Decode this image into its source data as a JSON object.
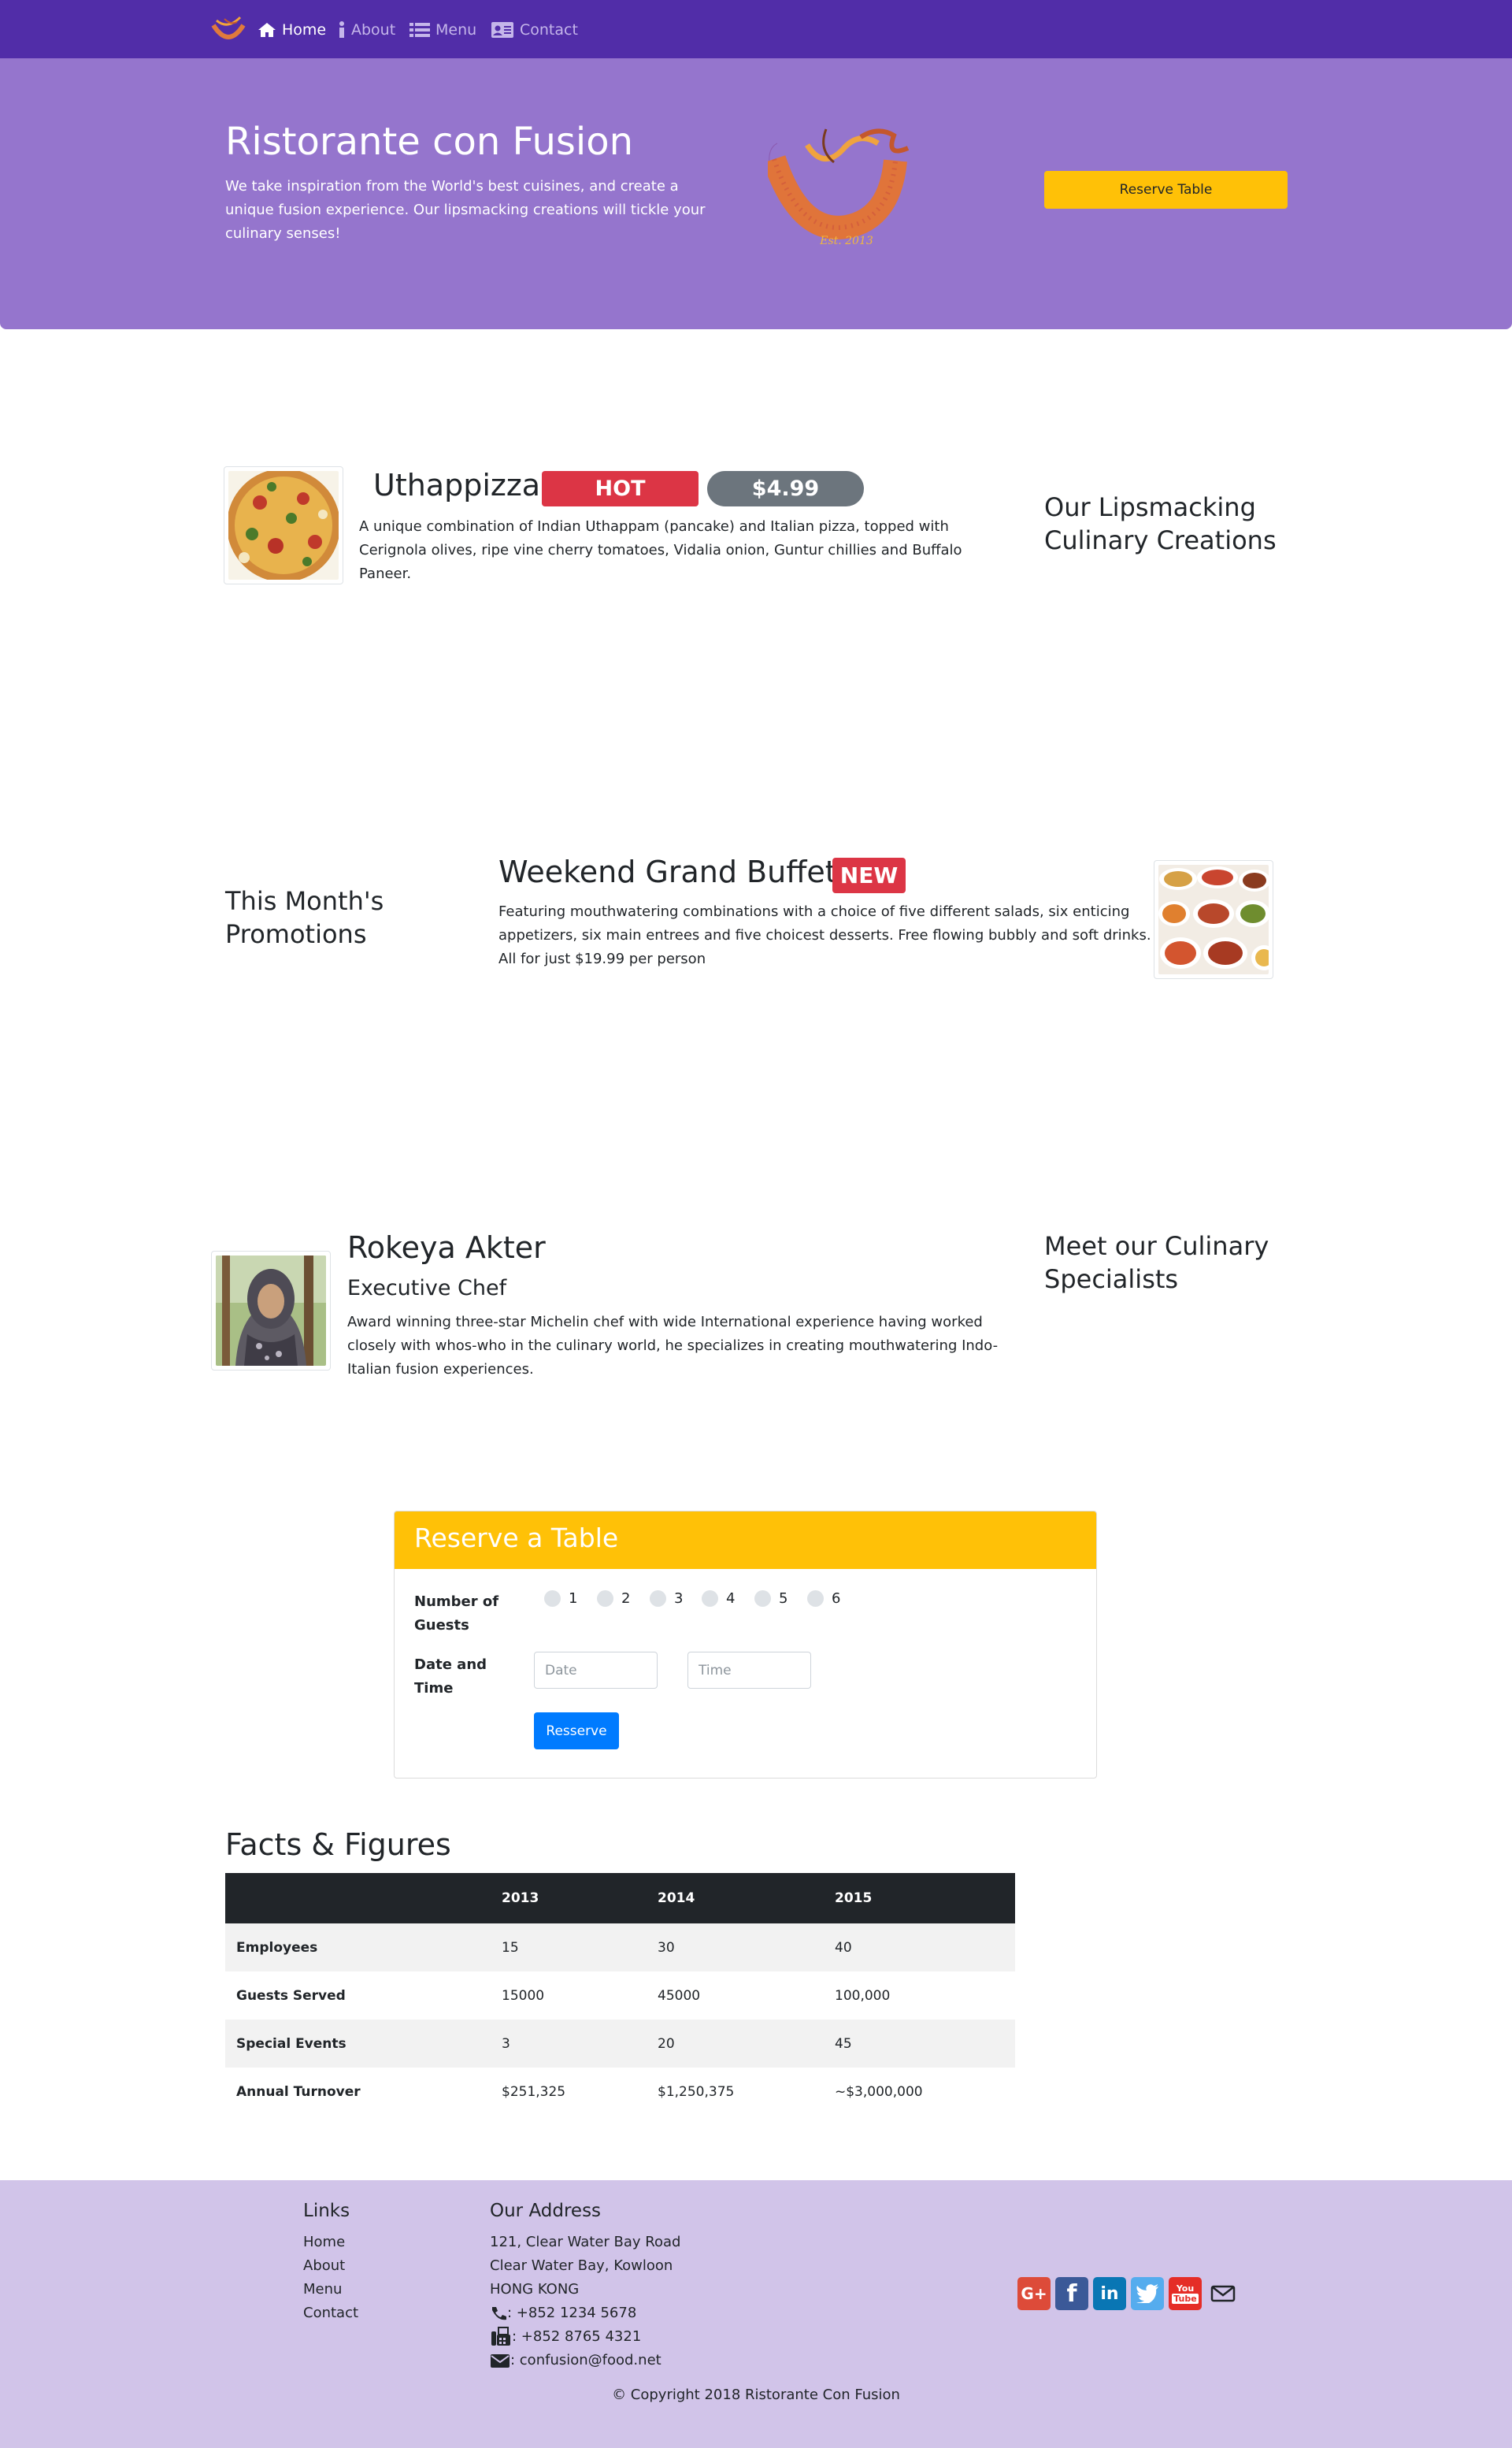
{
  "nav": {
    "items": [
      {
        "label": "Home",
        "icon": "home-icon",
        "active": true
      },
      {
        "label": "About",
        "icon": "info-icon"
      },
      {
        "label": "Menu",
        "icon": "list-icon"
      },
      {
        "label": "Contact",
        "icon": "address-card-icon"
      }
    ]
  },
  "jumbotron": {
    "title": "Ristorante con Fusion",
    "text": "We take inspiration from the World's best cuisines, and create a unique fusion experience. Our lipsmacking creations will tickle your culinary senses!",
    "logo_text": "Ristorante con Fusion",
    "logo_est": "Est. 2013",
    "reserve_label": "Reserve Table"
  },
  "dish": {
    "name": "Uthappizza",
    "badge_hot": "HOT",
    "price": "$4.99",
    "description": "A unique combination of Indian Uthappam (pancake) and Italian pizza, topped with Cerignola olives, ripe vine cherry tomatoes, Vidalia onion, Guntur chillies and Buffalo Paneer.",
    "section_title": "Our Lipsmacking Culinary Creations"
  },
  "promotion": {
    "section_title": "This Month's Promotions",
    "name": "Weekend Grand Buffet",
    "badge_new": "NEW",
    "description": "Featuring mouthwatering combinations with a choice of five different salads, six enticing appetizers, six main entrees and five choicest desserts. Free flowing bubbly and soft drinks. All for just $19.99 per person"
  },
  "leader": {
    "name": "Rokeya Akter",
    "designation": "Executive Chef",
    "description": "Award winning three-star Michelin chef with wide International experience having worked closely with whos-who in the culinary world, he specializes in creating mouthwatering Indo-Italian fusion experiences.",
    "section_title": "Meet our Culinary Specialists"
  },
  "reserve": {
    "title": "Reserve a Table",
    "guests_label": "Number of Guests",
    "guest_options": [
      "1",
      "2",
      "3",
      "4",
      "5",
      "6"
    ],
    "datetime_label": "Date and Time",
    "date_placeholder": "Date",
    "time_placeholder": "Time",
    "submit_label": "Resserve"
  },
  "facts": {
    "title": "Facts & Figures",
    "headers": [
      "",
      "2013",
      "2014",
      "2015"
    ],
    "rows": [
      [
        "Employees",
        "15",
        "30",
        "40"
      ],
      [
        "Guests Served",
        "15000",
        "45000",
        "100,000"
      ],
      [
        "Special Events",
        "3",
        "20",
        "45"
      ],
      [
        "Annual Turnover",
        "$251,325",
        "$1,250,375",
        "~$3,000,000"
      ]
    ]
  },
  "footer": {
    "links_title": "Links",
    "links": [
      "Home",
      "About",
      "Menu",
      "Contact"
    ],
    "address_title": "Our Address",
    "address_lines": [
      "121, Clear Water Bay Road",
      "Clear Water Bay, Kowloon",
      "HONG KONG"
    ],
    "phone": ": +852 1234 5678",
    "fax": ": +852 8765 4321",
    "email": ": confusion@food.net",
    "social": [
      "google-plus-icon",
      "facebook-icon",
      "linkedin-icon",
      "twitter-icon",
      "youtube-icon",
      "mail-icon"
    ],
    "copyright": "© Copyright 2018 Ristorante Con Fusion"
  },
  "colors": {
    "navbar": "#512da8",
    "jumbotron": "#9575cd",
    "footer": "#d1c4e9",
    "accent": "#ffc107",
    "danger": "#dc3545",
    "secondary": "#6c757d",
    "primary": "#007bff"
  }
}
